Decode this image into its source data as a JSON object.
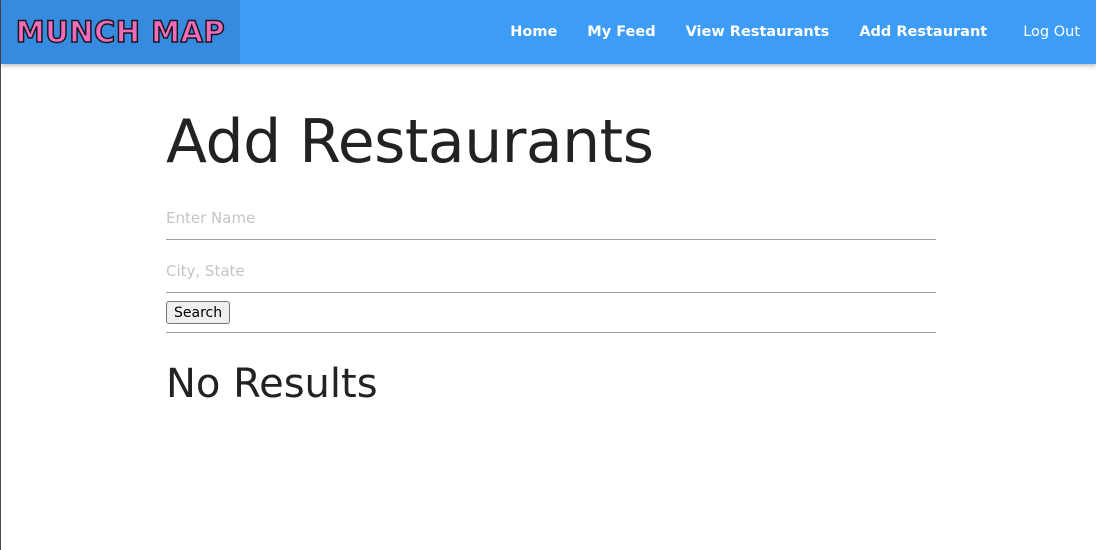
{
  "navbar": {
    "brand": "MUNCH MAP",
    "links": {
      "home": "Home",
      "my_feed": "My Feed",
      "view_restaurants": "View Restaurants",
      "add_restaurant": "Add Restaurant",
      "log_out": "Log Out"
    }
  },
  "main": {
    "title": "Add Restaurants",
    "name_input": {
      "value": "",
      "placeholder": "Enter Name"
    },
    "location_input": {
      "value": "",
      "placeholder": "City, State"
    },
    "search_label": "Search",
    "results_text": "No Results"
  },
  "colors": {
    "nav_bg": "#3d9cf6",
    "brand_bg": "#368ae0",
    "brand_text": "#f06bbd",
    "text_dark": "#222222"
  }
}
